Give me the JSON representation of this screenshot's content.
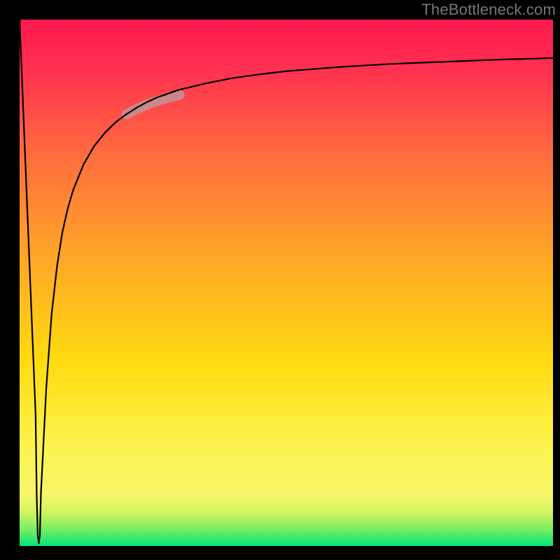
{
  "watermark": "TheBottleneck.com",
  "chart_data": {
    "type": "line",
    "title": "",
    "xlabel": "",
    "ylabel": "",
    "xlim": [
      0,
      100
    ],
    "ylim": [
      0,
      100
    ],
    "grid": false,
    "background_gradient_stops": [
      {
        "offset": 0.0,
        "color": "#00e67a"
      },
      {
        "offset": 0.033,
        "color": "#7fee60"
      },
      {
        "offset": 0.066,
        "color": "#d5f560"
      },
      {
        "offset": 0.1,
        "color": "#f7f66a"
      },
      {
        "offset": 0.2,
        "color": "#fcf24a"
      },
      {
        "offset": 0.35,
        "color": "#ffdb10"
      },
      {
        "offset": 0.55,
        "color": "#ffa626"
      },
      {
        "offset": 0.75,
        "color": "#ff6a3f"
      },
      {
        "offset": 0.9,
        "color": "#ff3250"
      },
      {
        "offset": 1.0,
        "color": "#ff184f"
      }
    ],
    "series": [
      {
        "name": "bottleneck-curve",
        "color": "#000000",
        "width": 2.2,
        "x": [
          0,
          1,
          2,
          3,
          3.2,
          3.4,
          3.6,
          3.8,
          4,
          5,
          6,
          7,
          8,
          9,
          10,
          12,
          14,
          16,
          18,
          20,
          22,
          24,
          26,
          28,
          30,
          35,
          40,
          45,
          50,
          55,
          60,
          65,
          70,
          75,
          80,
          85,
          90,
          95,
          100
        ],
        "values": [
          100,
          75,
          50,
          25,
          10,
          2,
          0.5,
          2,
          10,
          30,
          44,
          53,
          59.5,
          64,
          67.5,
          72.5,
          76,
          78.5,
          80.5,
          82,
          83.3,
          84.4,
          85.3,
          86,
          86.7,
          87.9,
          88.9,
          89.6,
          90.2,
          90.6,
          91.0,
          91.3,
          91.6,
          91.8,
          92.0,
          92.2,
          92.4,
          92.55,
          92.7
        ]
      },
      {
        "name": "highlight-segment",
        "color": "#c48f92",
        "width": 14,
        "opacity": 0.9,
        "linecap": "round",
        "x": [
          20,
          22,
          24,
          26,
          28,
          30
        ],
        "values": [
          82,
          83,
          83.9,
          84.6,
          85.2,
          85.7
        ]
      }
    ]
  }
}
